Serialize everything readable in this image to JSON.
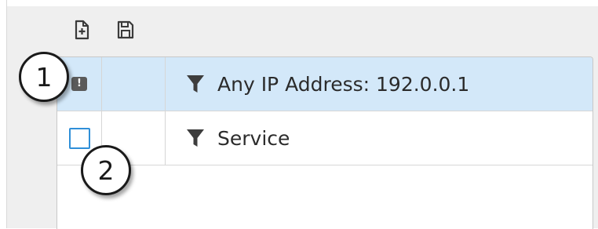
{
  "toolbar": {
    "buttons": [
      {
        "name": "new-file-button",
        "icon": "file-plus-icon"
      },
      {
        "name": "save-button",
        "icon": "floppy-disk-icon"
      }
    ]
  },
  "grid": {
    "rows": [
      {
        "status": "!",
        "status_icon": "warning-icon",
        "filter_icon": "filter-funnel-icon",
        "text": "Any IP Address: 192.0.0.1",
        "selected": true
      },
      {
        "status": "",
        "status_icon": "checkbox",
        "filter_icon": "filter-funnel-icon",
        "text": "Service",
        "selected": false
      }
    ]
  },
  "callouts": [
    {
      "label": "1"
    },
    {
      "label": "2"
    }
  ],
  "colors": {
    "selected_row": "#d3e8f9",
    "checkbox_border": "#2f8fd8",
    "panel_background": "#efefef"
  }
}
